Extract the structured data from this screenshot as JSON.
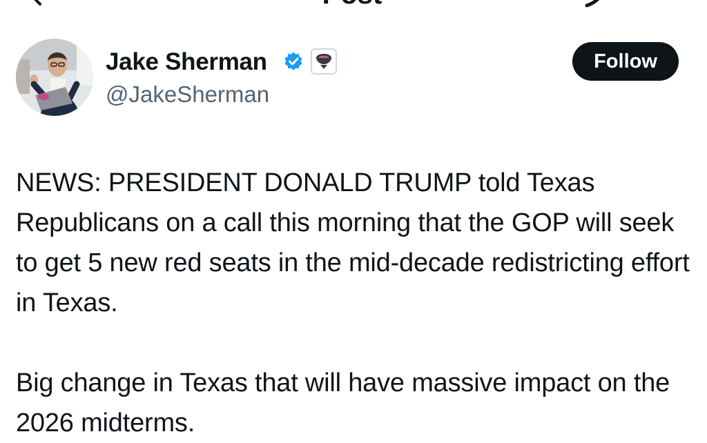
{
  "header": {
    "title": "Post",
    "back_icon": "arrow-left-icon",
    "action_icon": "grok-icon"
  },
  "author": {
    "name": "Jake Sherman",
    "handle": "@JakeSherman",
    "verified_icon": "verified-check-icon",
    "verified_color": "#1d9bf0",
    "affiliate_icon": "affiliate-badge-icon"
  },
  "follow_button": {
    "label": "Follow",
    "background": "#0f1419",
    "text_color": "#ffffff"
  },
  "tweet": {
    "paragraphs": [
      "NEWS: PRESIDENT DONALD TRUMP told Texas Republicans on a call this morning that the GOP will seek to get 5 new red seats in the mid-decade redistricting effort in Texas.",
      "Big change in Texas that will have massive impact on the 2026 midterms."
    ]
  }
}
